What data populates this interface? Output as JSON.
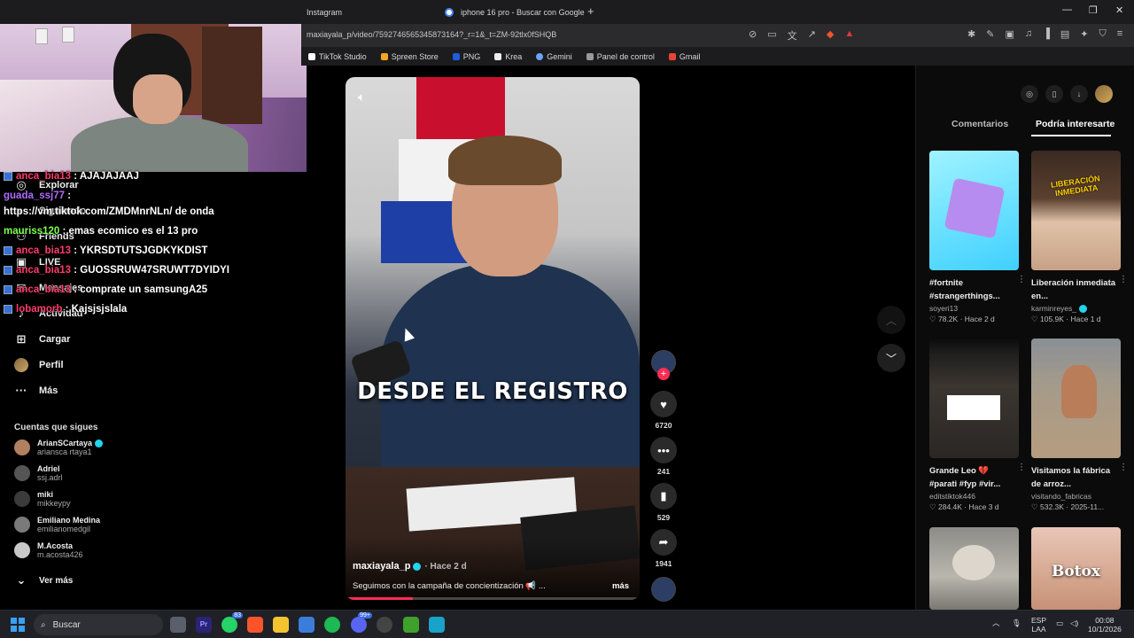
{
  "browser": {
    "tabs": [
      {
        "label": "Instagram"
      },
      {
        "label": "iphone 16 pro - Buscar con Google"
      }
    ],
    "url": "maxiayala_p/video/7592746565345873164?_r=1&_t=ZM-92tlx0fSHQB",
    "bookmarks": [
      "TikTok Studio",
      "Spreen Store",
      "PNG",
      "Krea",
      "Gemini",
      "Panel de control",
      "Gmail"
    ]
  },
  "sidebar": {
    "nav": [
      {
        "label": "Explorar",
        "icon": "compass-icon"
      },
      {
        "label": "Siguiendo",
        "icon": "following-icon"
      },
      {
        "label": "Friends",
        "icon": "friends-icon"
      },
      {
        "label": "LIVE",
        "icon": "live-icon"
      },
      {
        "label": "Mensajes",
        "icon": "message-icon",
        "badge": "15"
      },
      {
        "label": "Actividad",
        "icon": "bell-icon"
      },
      {
        "label": "Cargar",
        "icon": "plus-icon"
      },
      {
        "label": "Perfil",
        "icon": "profile-avatar"
      },
      {
        "label": "Más",
        "icon": "more-icon"
      }
    ],
    "following_title": "Cuentas que sigues",
    "accounts": [
      {
        "name": "ArianSCartaya",
        "handle": "ariansca rtaya1",
        "verified": true
      },
      {
        "name": "Adriel",
        "handle": "ssj.adrl",
        "verified": false
      },
      {
        "name": "miki",
        "handle": "mikkeypy",
        "verified": false
      },
      {
        "name": "Emiliano Medina",
        "handle": "emilianomedgil",
        "verified": false
      },
      {
        "name": "M.Acosta",
        "handle": "m.acosta426",
        "verified": false
      }
    ],
    "see_more": "Ver más"
  },
  "chat": [
    {
      "user": "anca_bia13",
      "message": "AJAJAJAAJ",
      "color": "#ff3b6b"
    },
    {
      "user": "guada_ssj77",
      "message": "",
      "color": "#b06bff"
    },
    {
      "user": "",
      "message": "https://vm.tiktok.com/ZMDMnrNLn/ de onda",
      "color": "#ffffff"
    },
    {
      "user": "mauriss120",
      "message": "emas ecomico es el 13 pro",
      "color": "#7cff4f"
    },
    {
      "user": "anca_bia13",
      "message": "YKRSDTUTSJGDKYKDIST",
      "color": "#ff3b6b"
    },
    {
      "user": "anca_bia13",
      "message": "GUOSSRUW47SRUWT7DYIDYI",
      "color": "#ff3b6b"
    },
    {
      "user": "anca_bia13",
      "message": "comprate un samsungA25",
      "color": "#ff3b6b"
    },
    {
      "user": "lobamorb",
      "message": "Kajsjsjslala",
      "color": "#ff3b6b"
    }
  ],
  "video": {
    "caption": "DESDE EL REGISTRO",
    "author": "maxiayala_p",
    "time": "· Hace 2 d",
    "description": "Seguimos con la campaña de concientización 📢 ...",
    "more": "más",
    "progress": 0.23
  },
  "actions": [
    {
      "icon": "heart-icon",
      "count": "6720"
    },
    {
      "icon": "comment-icon",
      "count": "241"
    },
    {
      "icon": "bookmark-icon",
      "count": "529"
    },
    {
      "icon": "share-icon",
      "count": "1941"
    }
  ],
  "right_panel": {
    "tabs": [
      "Comentarios",
      "Podría interesarte"
    ],
    "cards": [
      {
        "title": "#fortnite #strangerthings...",
        "author": "soyeri13",
        "likes": "78.2K",
        "age": "Hace 2 d",
        "theme": "fortnite"
      },
      {
        "title": "Liberación inmediata en...",
        "author": "karminreyes_",
        "likes": "105.9K",
        "age": "Hace 1 d",
        "theme": "liberacion",
        "overlay": "LIBERACIÓN INMEDIATA"
      },
      {
        "title": "Grande Leo 💔 #parati #fyp #vir...",
        "author": "editstiktok446",
        "likes": "284.4K",
        "age": "Hace 3 d",
        "theme": "leo"
      },
      {
        "title": "Visitamos la fábrica de arroz...",
        "author": "visitando_fabricas",
        "likes": "532.3K",
        "age": "2025-11...",
        "theme": "arroz"
      },
      {
        "title": "",
        "author": "",
        "likes": "",
        "age": "",
        "theme": "gato"
      },
      {
        "title": "",
        "author": "",
        "likes": "",
        "age": "",
        "theme": "botox",
        "overlay": "Botox"
      }
    ]
  },
  "taskbar": {
    "search": "Buscar",
    "lang": "ESP",
    "region": "LAA",
    "time": "00:08",
    "date": "10/1/2026",
    "badges": {
      "whatsapp": "83",
      "discord": "99+"
    }
  }
}
